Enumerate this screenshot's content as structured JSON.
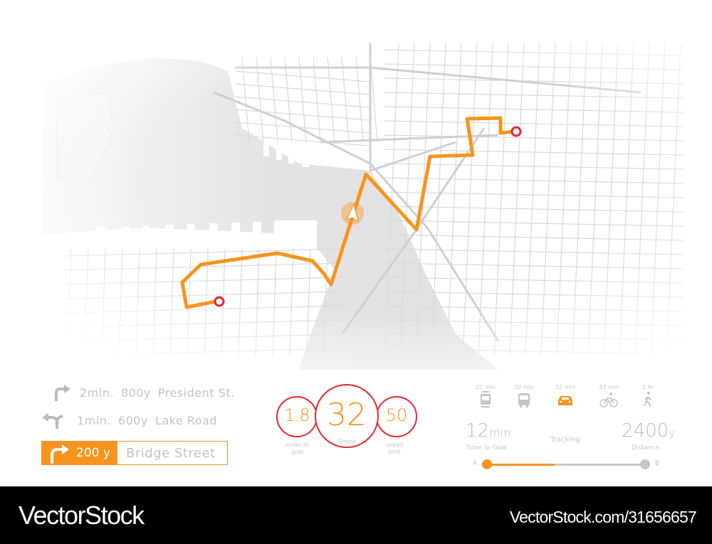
{
  "colors": {
    "route": "#f7941d",
    "pin": "#e8262e",
    "water": "#e3e3e3",
    "street": "#d6d6d6",
    "muted_text": "#c4c4c4"
  },
  "map": {
    "start_pin_icon": "location-ring-icon",
    "end_pin_icon": "location-ring-icon",
    "position_icon": "navigation-arrow-icon"
  },
  "directions": {
    "upcoming": [
      {
        "icon": "turn-right-icon",
        "time": "2min.",
        "distance": "800y",
        "street": "President St."
      },
      {
        "icon": "fork-left-icon",
        "time": "1min.",
        "distance": "600y",
        "street": "Lake Road"
      }
    ],
    "current": {
      "icon": "turn-right-icon",
      "distance": "200 y",
      "street": "Bridge Street"
    }
  },
  "gauges": {
    "miles": {
      "value": "1.8",
      "label": "miles to goal"
    },
    "speed": {
      "value": "32",
      "label": "Speed"
    },
    "limit": {
      "value": "50",
      "label": "speed limit"
    }
  },
  "modes": [
    {
      "name": "tram",
      "icon": "tram-icon",
      "time": "22 min",
      "active": false
    },
    {
      "name": "bus",
      "icon": "bus-icon",
      "time": "20 min",
      "active": false
    },
    {
      "name": "car",
      "icon": "car-icon",
      "time": "12 min",
      "active": true
    },
    {
      "name": "bike",
      "icon": "bicycle-icon",
      "time": "43 min",
      "active": false
    },
    {
      "name": "walk",
      "icon": "walking-icon",
      "time": "2 hr",
      "active": false
    }
  ],
  "trip": {
    "time_value": "12",
    "time_unit": "min",
    "time_label": "Time to Goal",
    "status": "Tracking",
    "distance_value": "2400",
    "distance_unit": "y",
    "distance_label": "Distance",
    "start_label": "A",
    "end_label": "B",
    "progress": 0.43
  },
  "footer": {
    "brand": "VectorStock",
    "url": "VectorStock.com/31656657"
  }
}
